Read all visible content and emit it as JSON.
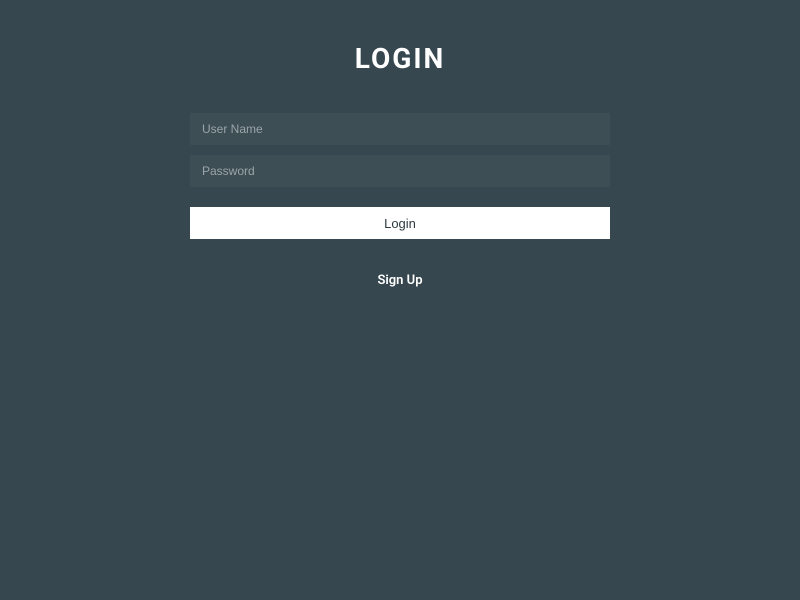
{
  "title": "LOGIN",
  "form": {
    "username_placeholder": "User Name",
    "password_placeholder": "Password",
    "login_button_label": "Login",
    "signup_label": "Sign Up"
  }
}
